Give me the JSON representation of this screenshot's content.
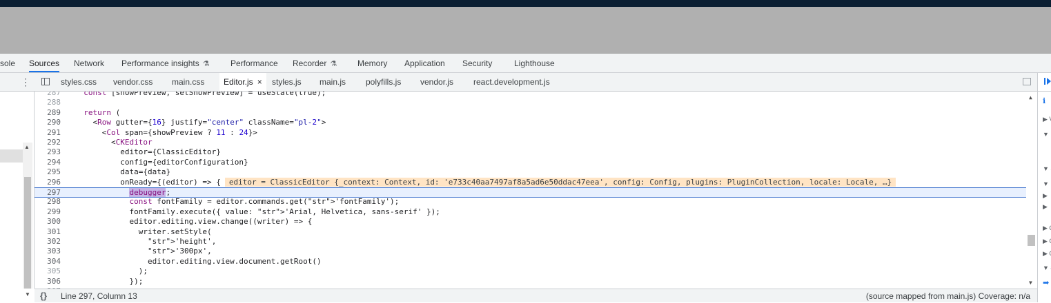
{
  "panel_tabs": [
    {
      "label": "sole",
      "active": false
    },
    {
      "label": "Sources",
      "active": true
    },
    {
      "label": "Network",
      "active": false
    },
    {
      "label": "Performance insights",
      "active": false,
      "experimental": true
    },
    {
      "label": "Performance",
      "active": false
    },
    {
      "label": "Recorder",
      "active": false,
      "experimental": true
    },
    {
      "label": "Memory",
      "active": false
    },
    {
      "label": "Application",
      "active": false
    },
    {
      "label": "Security",
      "active": false
    },
    {
      "label": "Lighthouse",
      "active": false
    }
  ],
  "flask_glyph": "⚗",
  "file_tabs": [
    {
      "label": "styles.css"
    },
    {
      "label": "vendor.css"
    },
    {
      "label": "main.css"
    },
    {
      "label": "Editor.js",
      "active": true,
      "close": "×"
    },
    {
      "label": "styles.js"
    },
    {
      "label": "main.js"
    },
    {
      "label": "polyfills.js"
    },
    {
      "label": "vendor.js"
    },
    {
      "label": "react.development.js"
    }
  ],
  "kebab_glyph": "⋮",
  "code_lines": [
    {
      "n": "287",
      "t": "  const [showPreview, setShowPreview] = useState(true);",
      "dim": true
    },
    {
      "n": "288",
      "t": "",
      "dim": true
    },
    {
      "n": "289",
      "t": "  return ("
    },
    {
      "n": "290",
      "t": "    <Row gutter={16} justify=\"center\" className=\"pl-2\">"
    },
    {
      "n": "291",
      "t": "      <Col span={showPreview ? 11 : 24}>"
    },
    {
      "n": "292",
      "t": "        <CKEditor"
    },
    {
      "n": "293",
      "t": "          editor={ClassicEditor}"
    },
    {
      "n": "294",
      "t": "          config={editorConfiguration}"
    },
    {
      "n": "295",
      "t": "          data={data}"
    },
    {
      "n": "296",
      "t": "          onReady={(editor) => {",
      "inline": "editor = ClassicEditor {_context: Context, id: 'e733c40aa7497af8a5ad6e50ddac47eea', config: Config, plugins: PluginCollection, locale: Locale, …}"
    },
    {
      "n": "297",
      "t": "            debugger;",
      "current": true,
      "selected": "debugger"
    },
    {
      "n": "298",
      "t": "            const fontFamily = editor.commands.get('fontFamily');"
    },
    {
      "n": "299",
      "t": "            fontFamily.execute({ value: 'Arial, Helvetica, sans-serif' });"
    },
    {
      "n": "300",
      "t": "            editor.editing.view.change((writer) => {"
    },
    {
      "n": "301",
      "t": "              writer.setStyle("
    },
    {
      "n": "302",
      "t": "                'height',"
    },
    {
      "n": "303",
      "t": "                '300px',"
    },
    {
      "n": "304",
      "t": "                editor.editing.view.document.getRoot()"
    },
    {
      "n": "305",
      "t": "              );",
      "dim": true
    },
    {
      "n": "306",
      "t": "            });"
    },
    {
      "n": "307",
      "t": "",
      "dim": true
    }
  ],
  "status": {
    "braces": "{}",
    "position": "Line 297, Column 13",
    "mapped": "(source mapped from main.js) Coverage: n/a"
  },
  "right_pane": {
    "info_glyph": "ℹ",
    "row_glyphs": [
      "▶ V",
      "▼ I",
      "▼ S",
      "▼ L",
      "▶",
      "▶",
      "▶ C",
      "▶ C",
      "▶ C",
      "▼ 8",
      "➡"
    ]
  },
  "colors": {
    "accent": "#1a73e8",
    "current_line_bg": "#e8f0fe",
    "inline_value_bg": "#ffe4c4",
    "selection_bg": "#c5b4e6"
  }
}
